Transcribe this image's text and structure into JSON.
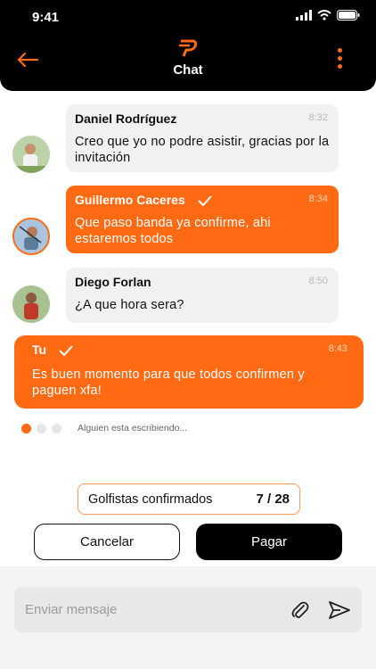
{
  "status_bar": {
    "time": "9:41"
  },
  "header": {
    "title": "Chat"
  },
  "messages": [
    {
      "author": "Daniel Rodríguez",
      "time": "8:32",
      "text": "Creo que yo no podre asistir, gracias por la invitación",
      "style": "grey"
    },
    {
      "author": "Guillermo Caceres",
      "time": "8:34",
      "text": "Que paso banda ya confirme, ahi estaremos todos",
      "style": "orange"
    },
    {
      "author": "Diego Forlan",
      "time": "8:50",
      "text": "¿A que hora sera?",
      "style": "grey"
    },
    {
      "author": "Tu",
      "time": "8:43",
      "text": "Es buen momento para que todos confirmen y paguen xfa!",
      "style": "orange"
    }
  ],
  "typing": {
    "text": "Alguien esta escribiendo..."
  },
  "confirmed": {
    "label": "Golfistas confirmados",
    "count": "7 / 28"
  },
  "actions": {
    "cancel_label": "Cancelar",
    "pay_label": "Pagar"
  },
  "composer": {
    "placeholder": "Enviar mensaje"
  },
  "colors": {
    "accent": "#FF6A13",
    "header_bg": "#000000",
    "bubble_grey": "#F1F1F1"
  }
}
